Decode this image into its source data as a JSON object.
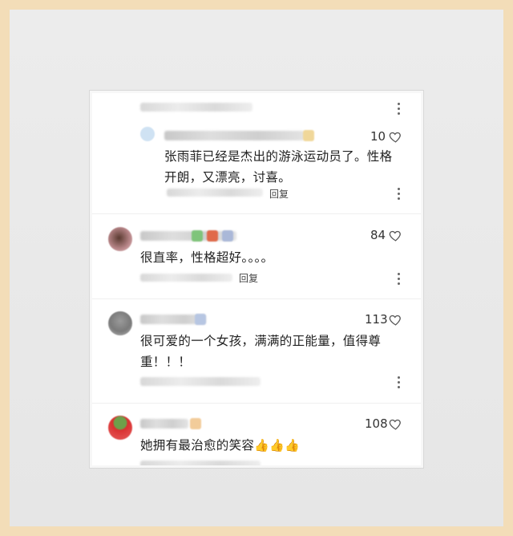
{
  "comments": [
    {
      "text": "张雨菲已经是杰出的游泳运动员了。性格开朗，又漂亮，讨喜。",
      "likes": "10",
      "reply": "回复"
    },
    {
      "text": "很直率，性格超好。。。。",
      "likes": "84",
      "reply": "回复"
    },
    {
      "text": "很可爱的一个女孩，满满的正能量，值得尊重！！！",
      "likes": "113"
    },
    {
      "text": "她拥有最治愈的笑容",
      "likes": "108",
      "emojis": "👍👍👍"
    }
  ],
  "colors": {
    "frame": "#f3ddb8",
    "mat": "#e9e9e9",
    "card": "#ffffff"
  },
  "icons": [
    "heart-outline-icon",
    "more-vertical-icon",
    "thumbs-up-emoji"
  ]
}
